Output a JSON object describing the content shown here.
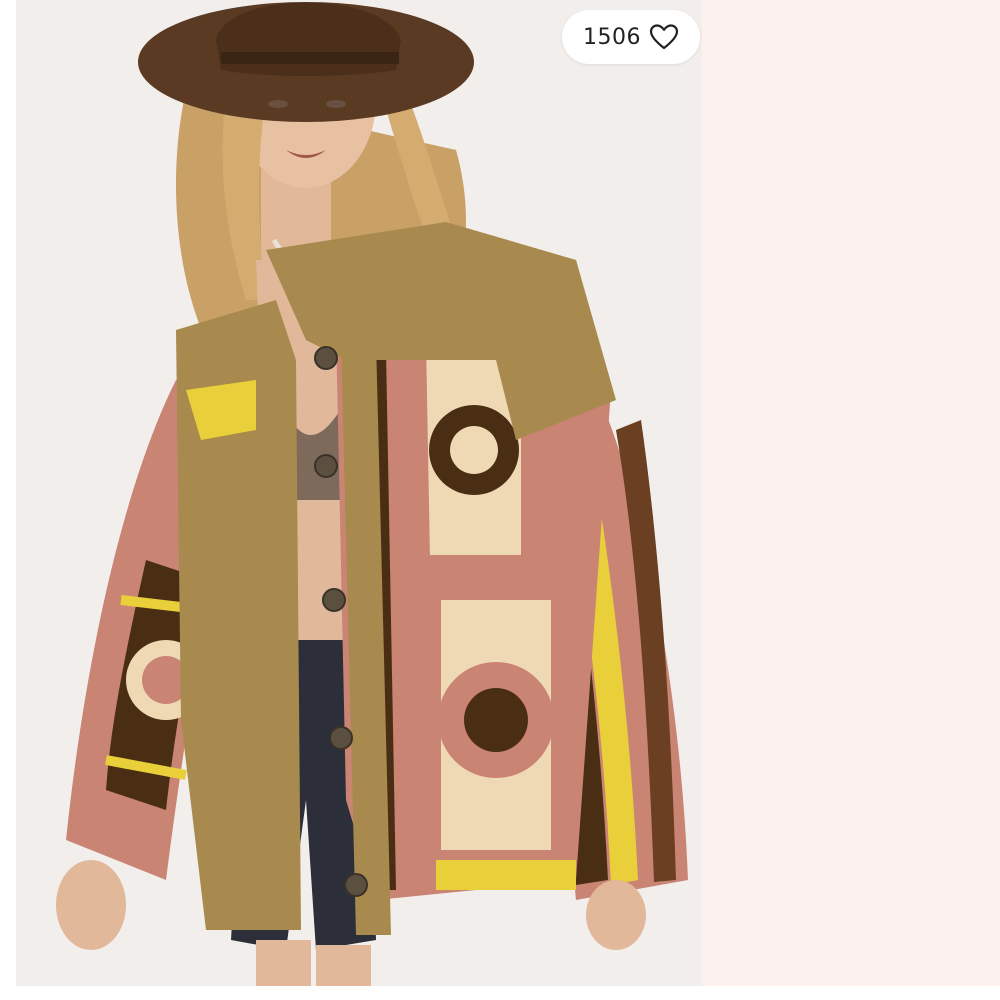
{
  "listing": {
    "like_count": "1506"
  },
  "icons": {
    "like": "heart-outline-icon"
  },
  "colors": {
    "photo_background": "#f2eeec",
    "side_panel": "#fcf1ef",
    "hat": "#5a3a22",
    "jacket_khaki": "#a88a4e",
    "crochet_pink": "#c98474",
    "crochet_yellow": "#e9cf3a",
    "crochet_brown": "#4a2e14",
    "crochet_cream": "#efd9b4",
    "denim": "#2c2f3a"
  }
}
